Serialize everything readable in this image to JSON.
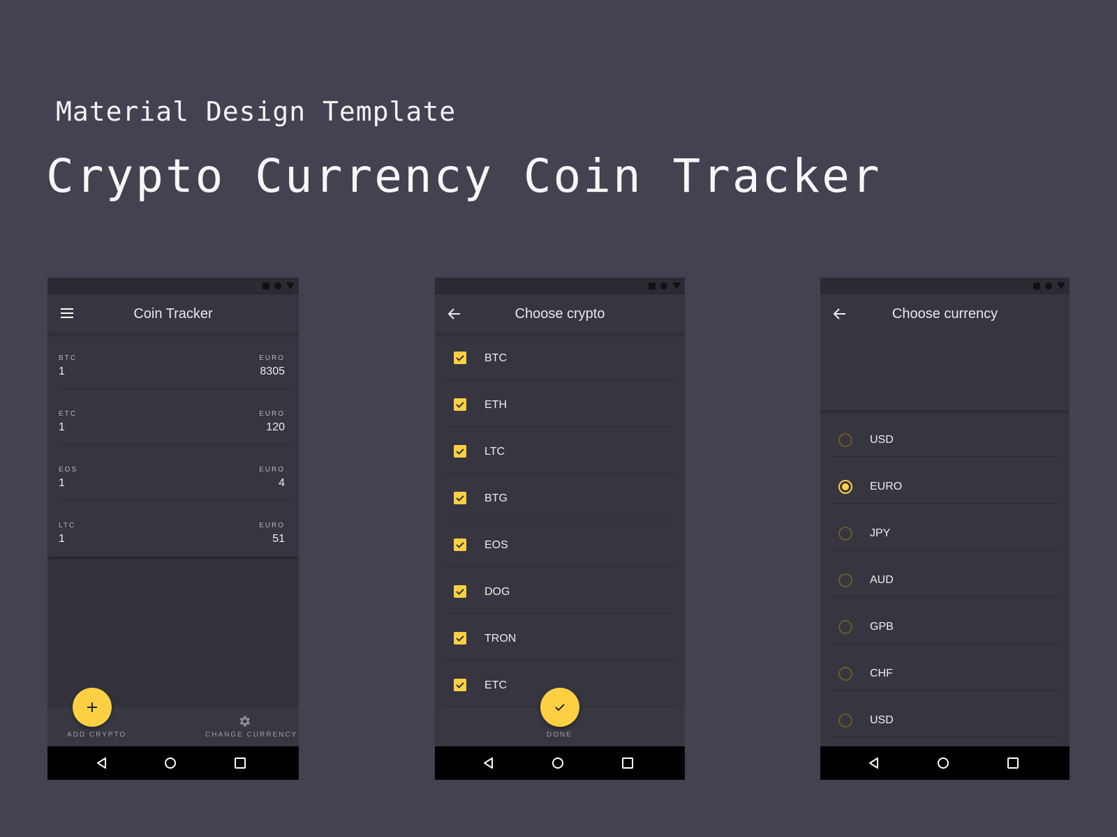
{
  "header": {
    "subtitle": "Material Design Template",
    "title": "Crypto Currency Coin Tracker"
  },
  "colors": {
    "background": "#434251",
    "surface": "#363540",
    "accent": "#fdd044",
    "navbar": "#000000"
  },
  "screen1": {
    "title": "Coin Tracker",
    "menu_icon": "hamburger-menu-icon",
    "coins": [
      {
        "symbol": "BTC",
        "quantity": "1",
        "currency": "EURO",
        "value": "8305"
      },
      {
        "symbol": "ETC",
        "quantity": "1",
        "currency": "EURO",
        "value": "120"
      },
      {
        "symbol": "EOS",
        "quantity": "1",
        "currency": "EURO",
        "value": "4"
      },
      {
        "symbol": "LTC",
        "quantity": "1",
        "currency": "EURO",
        "value": "51"
      }
    ],
    "add_label": "ADD CRYPTO",
    "add_icon": "plus",
    "change_currency_label": "CHANGE CURRENCY",
    "change_currency_icon": "gear-icon"
  },
  "screen2": {
    "title": "Choose crypto",
    "back_icon": "arrow-left-icon",
    "items": [
      {
        "label": "BTC",
        "checked": true
      },
      {
        "label": "ETH",
        "checked": true
      },
      {
        "label": "LTC",
        "checked": true
      },
      {
        "label": "BTG",
        "checked": true
      },
      {
        "label": "EOS",
        "checked": true
      },
      {
        "label": "DOG",
        "checked": true
      },
      {
        "label": "TRON",
        "checked": true
      },
      {
        "label": "ETC",
        "checked": true
      }
    ],
    "done_label": "DONE"
  },
  "screen3": {
    "title": "Choose currency",
    "back_icon": "arrow-left-icon",
    "selected": "EURO",
    "options": [
      {
        "label": "USD",
        "selected": false
      },
      {
        "label": "EURO",
        "selected": true
      },
      {
        "label": "JPY",
        "selected": false
      },
      {
        "label": "AUD",
        "selected": false
      },
      {
        "label": "GPB",
        "selected": false
      },
      {
        "label": "CHF",
        "selected": false
      },
      {
        "label": "USD",
        "selected": false
      }
    ]
  },
  "navbar": {
    "back": "back-triangle-icon",
    "home": "home-circle-icon",
    "recents": "recents-square-icon"
  }
}
